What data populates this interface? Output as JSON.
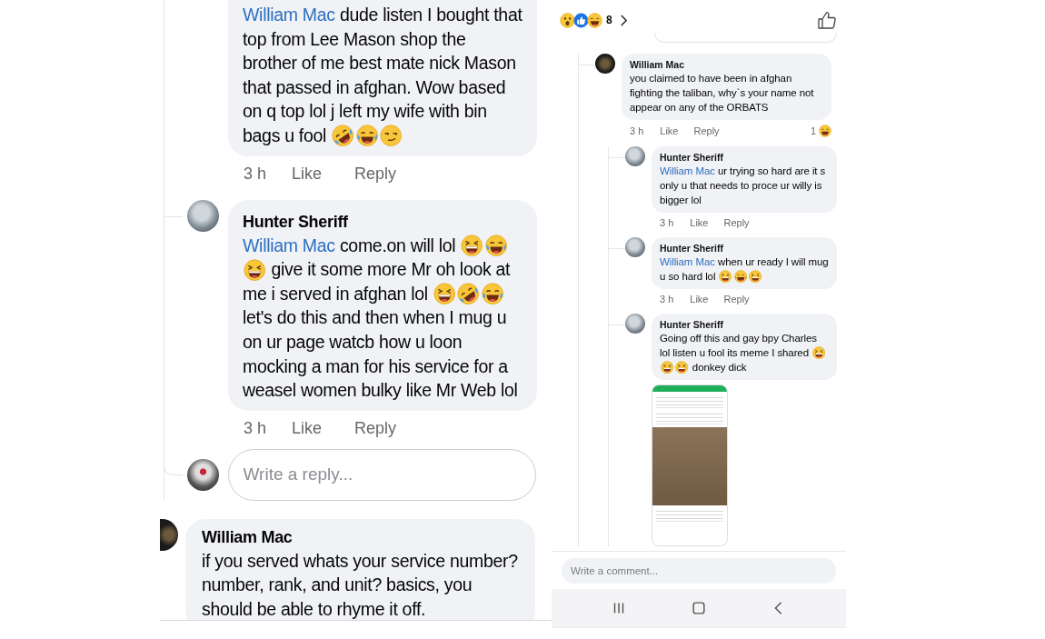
{
  "left_panel": {
    "comments": [
      {
        "body": [
          {
            "kind": "mention",
            "text": "William Mac"
          },
          {
            "kind": "text",
            "text": " dude listen I bought that top from Lee Mason shop the brother of me best mate nick Mason that passed in afghan. Wow based on q top lol j left my wife with bin bags u fool "
          },
          {
            "kind": "rofl"
          },
          {
            "kind": "joy"
          },
          {
            "kind": "smirk"
          }
        ],
        "time": "3 h",
        "actions": [
          "Like",
          "Reply"
        ]
      },
      {
        "author": "Hunter Sheriff",
        "body": [
          {
            "kind": "mention",
            "text": "William Mac"
          },
          {
            "kind": "text",
            "text": " come.on will lol "
          },
          {
            "kind": "grin"
          },
          {
            "kind": "joy"
          },
          {
            "kind": "grin"
          },
          {
            "kind": "text",
            "text": " give it some more Mr oh look at me i served in afghan lol "
          },
          {
            "kind": "grin"
          },
          {
            "kind": "rofl"
          },
          {
            "kind": "joy"
          },
          {
            "kind": "text",
            "text": " let's do this and then when I mug u on ur page watcb how u loon mocking a man for his service for a weasel women bulky like Mr Web lol"
          }
        ],
        "time": "3 h",
        "actions": [
          "Like",
          "Reply"
        ]
      }
    ],
    "reply_field": {
      "placeholder": "Write a reply..."
    },
    "next_comment": {
      "author": "William Mac",
      "body": [
        {
          "kind": "text",
          "text": "if you served whats your service number? number, rank, and unit? basics, you should be able to rhyme it off."
        }
      ]
    }
  },
  "right_panel": {
    "reactions": {
      "icons": [
        {
          "kind": "wow"
        },
        {
          "kind": "like"
        },
        {
          "kind": "haha"
        }
      ],
      "count": "8"
    },
    "comment": {
      "author": "William Mac",
      "body": [
        {
          "kind": "text",
          "text": "you claimed to have been in afghan fighting the taliban, why`s your name not appear on any of the ORBATS"
        }
      ],
      "time": "3 h",
      "actions": [
        "Like",
        "Reply"
      ],
      "reaction": {
        "count": "1",
        "kind": "haha"
      },
      "children": [
        {
          "author": "Hunter Sheriff",
          "body": [
            {
              "kind": "mention",
              "text": "William Mac"
            },
            {
              "kind": "text",
              "text": " ur trying so hard are it s only u that needs to proce ur willy is bigger lol"
            }
          ],
          "time": "3 h",
          "actions": [
            "Like",
            "Reply"
          ]
        },
        {
          "author": "Hunter Sheriff",
          "body": [
            {
              "kind": "mention",
              "text": "William Mac"
            },
            {
              "kind": "text",
              "text": " when ur ready I will mug u so hard lol "
            },
            {
              "kind": "grin"
            },
            {
              "kind": "joy"
            },
            {
              "kind": "grin"
            }
          ],
          "time": "3 h",
          "actions": [
            "Like",
            "Reply"
          ]
        },
        {
          "author": "Hunter Sheriff",
          "body": [
            {
              "kind": "text",
              "text": "Going off  this and gay bpy Charles lol listen u fool its meme I shared "
            },
            {
              "kind": "sweat"
            },
            {
              "kind": "sweat"
            },
            {
              "kind": "sweat"
            },
            {
              "kind": "text",
              "text": " donkey dick"
            }
          ],
          "attachment": {
            "kind": "image"
          }
        }
      ]
    },
    "comment_field": {
      "placeholder": "Write a comment..."
    }
  }
}
